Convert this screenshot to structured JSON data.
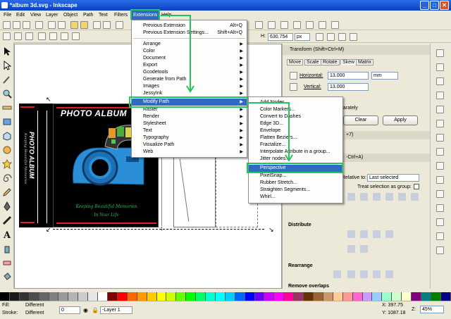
{
  "window": {
    "title": "*album 3d.svg - Inkscape",
    "buttons": [
      "_",
      "□",
      "✕"
    ]
  },
  "menubar": [
    "File",
    "Edit",
    "View",
    "Layer",
    "Object",
    "Path",
    "Text",
    "Filters",
    "Extensions",
    "Help"
  ],
  "toolbar": {
    "height_label": "H:",
    "height_value": "630.754",
    "unit": "px"
  },
  "extensions_menu": {
    "items": [
      {
        "label": "Previous Extension",
        "shortcut": "Alt+Q"
      },
      {
        "label": "Previous Extension Settings...",
        "shortcut": "Shift+Alt+Q"
      },
      {
        "label": "Arrange"
      },
      {
        "label": "Color"
      },
      {
        "label": "Document"
      },
      {
        "label": "Export"
      },
      {
        "label": "Gcodetools"
      },
      {
        "label": "Generate from Path"
      },
      {
        "label": "Images"
      },
      {
        "label": "JessyInk"
      },
      {
        "label": "Modify Path"
      },
      {
        "label": "Raster"
      },
      {
        "label": "Render"
      },
      {
        "label": "Stylesheet"
      },
      {
        "label": "Text"
      },
      {
        "label": "Typography"
      },
      {
        "label": "Visualize Path"
      },
      {
        "label": "Web"
      }
    ]
  },
  "modify_path_menu": {
    "items": [
      "Add Nodes...",
      "Color Markers...",
      "Convert to Dashes",
      "Edge 3D...",
      "Envelope",
      "Flatten Beziers...",
      "Fractalize...",
      "Interpolate Attribute in a group...",
      "Jitter nodes...",
      "Perspective",
      "PixelSnap...",
      "Rubber Stretch...",
      "Straighten Segments...",
      "Whirl..."
    ],
    "highlighted": "Perspective"
  },
  "album": {
    "title": "PHOTO ALBUM",
    "side_title": "PHOTO ALBUM",
    "side_script": "Keeping Beautiful Memories",
    "tagline1": "Keeping Beautiful Memories",
    "tagline2": "In Your Life"
  },
  "panel": {
    "transform_title": "Transform (Shift+Ctrl+M)",
    "tabs": [
      "Move",
      "Scale",
      "Rotate",
      "Skew",
      "Matrix"
    ],
    "active_tab": "Skew",
    "horizontal_label": "Horizontal:",
    "horizontal_value": "13.000",
    "vertical_label": "Vertical:",
    "vertical_value": "13.000",
    "unit": "mm",
    "separately": "parately",
    "clear": "Clear",
    "apply": "Apply",
    "align_header_fragment": "+7)",
    "align_header_fragment2": "-Ctrl+A)",
    "relative_to_label": "Relative to:",
    "relative_to_value": "Last selected",
    "treat_group": "Treat selection as group:",
    "distribute": "Distribute",
    "rearrange": "Rearrange",
    "remove_overlaps": "Remove overlaps"
  },
  "status": {
    "fill_label": "Fill:",
    "fill_value": "Different",
    "stroke_label": "Stroke:",
    "stroke_value": "Different",
    "opacity": "0",
    "layer": "-Layer 1",
    "x": "X: 397.75",
    "y": "Y: 1087.18",
    "zoom_label": "Z:",
    "zoom_value": "45%"
  },
  "palette": [
    "#000000",
    "#1a1a1a",
    "#333333",
    "#4d4d4d",
    "#666666",
    "#808080",
    "#999999",
    "#b3b3b3",
    "#cccccc",
    "#e6e6e6",
    "#ffffff",
    "#800000",
    "#ff0000",
    "#ff6600",
    "#ff9900",
    "#ffcc00",
    "#ffff00",
    "#ccff00",
    "#66ff00",
    "#00ff00",
    "#00ff66",
    "#00ffcc",
    "#00ffff",
    "#00ccff",
    "#0066ff",
    "#0000ff",
    "#6600ff",
    "#cc00ff",
    "#ff00ff",
    "#ff0099",
    "#993366",
    "#663300",
    "#996633",
    "#cc9966",
    "#ffcc99",
    "#ff9999",
    "#ff66cc",
    "#cc99ff",
    "#99ccff",
    "#99ffcc",
    "#ccffcc",
    "#ffffcc",
    "#800080",
    "#008080",
    "#008000",
    "#000080"
  ]
}
